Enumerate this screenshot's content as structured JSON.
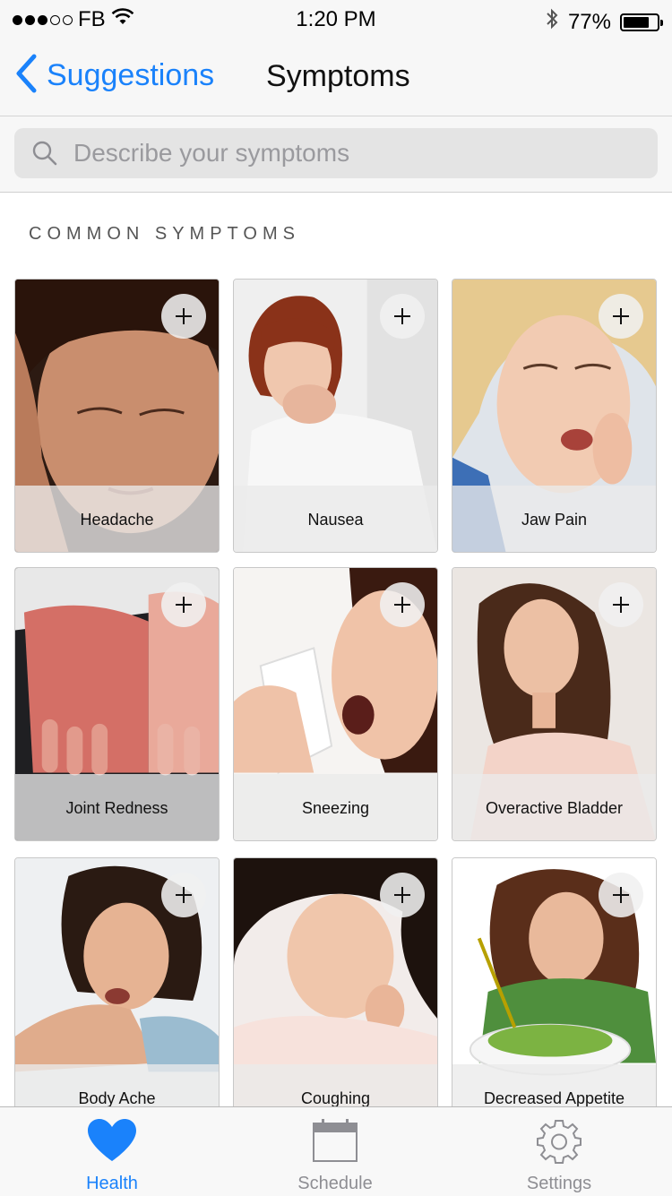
{
  "status_bar": {
    "carrier": "FB",
    "time": "1:20 PM",
    "battery_percent": "77%",
    "battery_level": 0.77,
    "signal_dots_filled": 3,
    "signal_dots_total": 5
  },
  "nav": {
    "back_label": "Suggestions",
    "title": "Symptoms"
  },
  "search": {
    "placeholder": "Describe your symptoms"
  },
  "section": {
    "title": "COMMON SYMPTOMS"
  },
  "symptoms": [
    {
      "label": "Headache",
      "add": "+"
    },
    {
      "label": "Nausea",
      "add": "+"
    },
    {
      "label": "Jaw Pain",
      "add": "+"
    },
    {
      "label": "Joint Redness",
      "add": "+"
    },
    {
      "label": "Sneezing",
      "add": "+"
    },
    {
      "label": "Overactive Bladder",
      "add": "+"
    },
    {
      "label": "Body Ache",
      "add": "+"
    },
    {
      "label": "Coughing",
      "add": "+"
    },
    {
      "label": "Decreased Appetite",
      "add": "+"
    }
  ],
  "tabs": [
    {
      "label": "Health",
      "icon": "heart-icon",
      "active": true
    },
    {
      "label": "Schedule",
      "icon": "calendar-icon",
      "active": false
    },
    {
      "label": "Settings",
      "icon": "gear-icon",
      "active": false
    }
  ],
  "colors": {
    "accent": "#1a82fb",
    "inactive": "#8e8e93"
  }
}
